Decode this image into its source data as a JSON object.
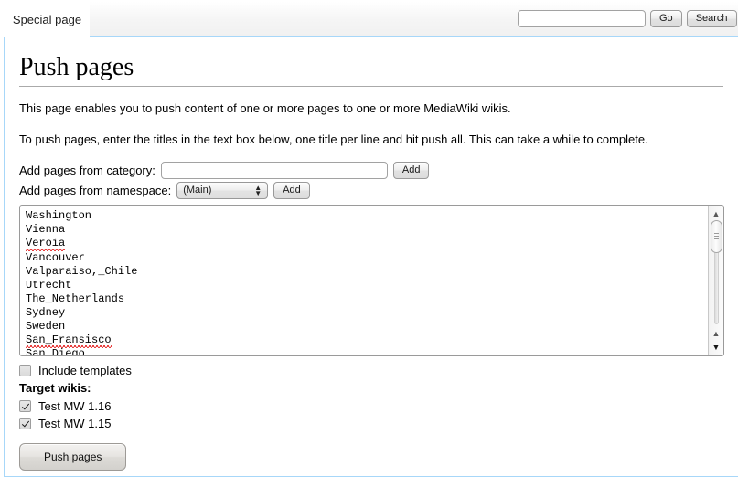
{
  "tabs": [
    {
      "label": "Special page",
      "active": true
    }
  ],
  "search": {
    "value": "",
    "placeholder": "",
    "go_label": "Go",
    "search_label": "Search"
  },
  "page": {
    "title": "Push pages",
    "intro_1": "This page enables you to push content of one or more pages to one or more MediaWiki wikis.",
    "intro_2": "To push pages, enter the titles in the text box below, one title per line and hit push all. This can take a while to complete."
  },
  "form": {
    "category_row": {
      "label": "Add pages from category:",
      "input_value": "",
      "input_placeholder": "",
      "add_label": "Add"
    },
    "namespace_row": {
      "label": "Add pages from namespace:",
      "selected": "(Main)",
      "options": [
        "(Main)"
      ],
      "add_label": "Add"
    },
    "pages_textarea": {
      "lines": [
        {
          "text": "Washington",
          "misspelled": false
        },
        {
          "text": "Vienna",
          "misspelled": false
        },
        {
          "text": "Veroia",
          "misspelled": true
        },
        {
          "text": "Vancouver",
          "misspelled": false
        },
        {
          "text": "Valparaiso,_Chile",
          "misspelled": false
        },
        {
          "text": "Utrecht",
          "misspelled": false
        },
        {
          "text": "The_Netherlands",
          "misspelled": false
        },
        {
          "text": "Sydney",
          "misspelled": false
        },
        {
          "text": "Sweden",
          "misspelled": false
        },
        {
          "text": "San_Fransisco",
          "misspelled": true
        },
        {
          "text": "San_Diego",
          "misspelled": false
        }
      ]
    },
    "include_templates": {
      "label": "Include templates",
      "checked": false
    },
    "target_wikis_heading": "Target wikis:",
    "target_wikis": [
      {
        "label": "Test MW 1.16",
        "checked": true
      },
      {
        "label": "Test MW 1.15",
        "checked": true
      }
    ],
    "submit_label": "Push pages"
  },
  "scrollbar": {
    "up_arrow": "▲",
    "down_arrow": "▼"
  },
  "colors": {
    "accent_border": "#a7d7f9",
    "heading_rule": "#aaaaaa",
    "spellcheck_underline": "#e00000",
    "text": "#000000"
  }
}
